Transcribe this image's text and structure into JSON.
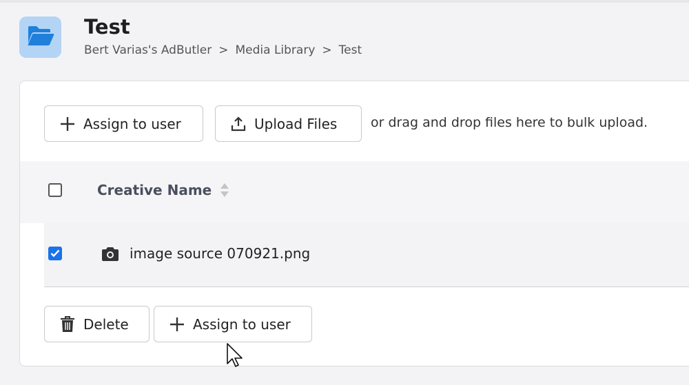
{
  "header": {
    "title": "Test",
    "breadcrumb": [
      "Bert Varias's AdButler",
      "Media Library",
      "Test"
    ],
    "breadcrumb_separator": ">",
    "folder_icon": "folder-open-icon",
    "folder_tile_color": "#b3d4f5",
    "folder_icon_color": "#1f7fdb"
  },
  "toolbar": {
    "assign_label": "Assign to user",
    "upload_label": "Upload Files",
    "drop_hint": "or drag and drop files here to bulk upload."
  },
  "table": {
    "columns": [
      {
        "label": "Creative Name",
        "sortable": true
      }
    ],
    "rows": [
      {
        "name": "image source 070921.png",
        "checked": true,
        "icon": "camera-icon"
      }
    ],
    "select_all_checked": false
  },
  "actions": {
    "delete_label": "Delete",
    "assign_label": "Assign to user"
  },
  "colors": {
    "checkbox_checked": "#1a73e8",
    "header_text": "#4a4f5e"
  }
}
